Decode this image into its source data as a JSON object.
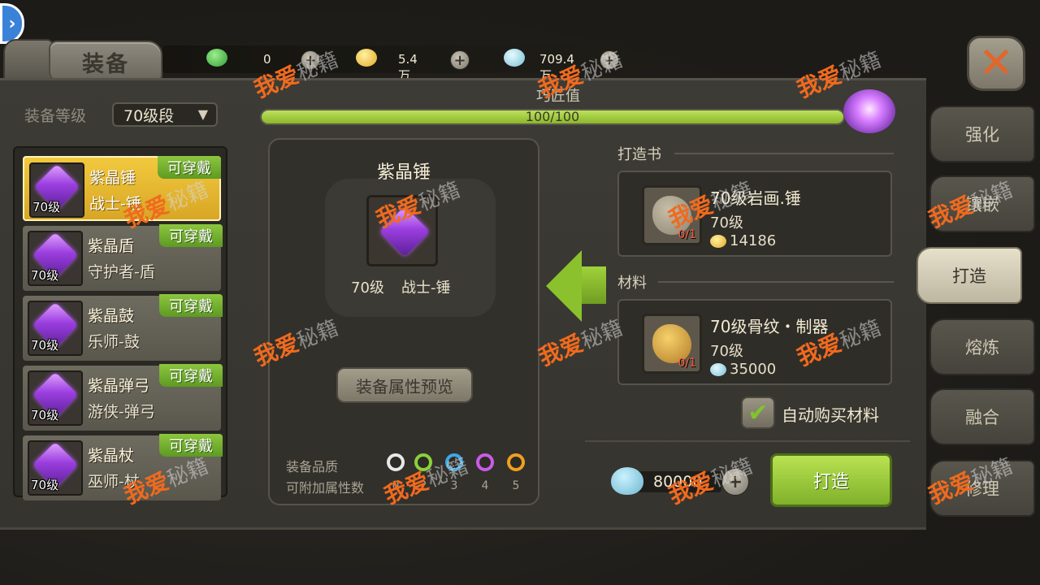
{
  "title": "装备",
  "currencies": [
    {
      "icon": "green-gem-icon",
      "value": "0",
      "color": "#3fb24a"
    },
    {
      "icon": "gold-coin-icon",
      "value": "5.4万",
      "color": "#f2c33a"
    },
    {
      "icon": "shell-icon",
      "value": "709.4万",
      "color": "#9fd7ea"
    }
  ],
  "level_filter": {
    "label": "装备等级",
    "selected": "70级段"
  },
  "progress": {
    "label": "巧匠值",
    "text": "100/100",
    "fraction": 1.0
  },
  "equipment_list": [
    {
      "name": "紫晶锤",
      "role": "战士-锤",
      "level": "70级",
      "tag": "可穿戴",
      "selected": true
    },
    {
      "name": "紫晶盾",
      "role": "守护者-盾",
      "level": "70级",
      "tag": "可穿戴",
      "selected": false
    },
    {
      "name": "紫晶鼓",
      "role": "乐师-鼓",
      "level": "70级",
      "tag": "可穿戴",
      "selected": false
    },
    {
      "name": "紫晶弹弓",
      "role": "游侠-弹弓",
      "level": "70级",
      "tag": "可穿戴",
      "selected": false
    },
    {
      "name": "紫晶杖",
      "role": "巫师-杖",
      "level": "70级",
      "tag": "可穿戴",
      "selected": false
    }
  ],
  "detail": {
    "name": "紫晶锤",
    "level": "70级",
    "class": "战士-锤",
    "preview_button": "装备属性预览",
    "quality_label": "装备品质",
    "attr_label": "可附加属性数",
    "qualities": [
      {
        "color": "#e8e8e8",
        "count": "0"
      },
      {
        "color": "#8bd13a",
        "count": "2"
      },
      {
        "color": "#3ea8e6",
        "count": "3"
      },
      {
        "color": "#c95ce8",
        "count": "4"
      },
      {
        "color": "#f0a020",
        "count": "5"
      }
    ]
  },
  "forge_book": {
    "section_title": "打造书",
    "name": "70级岩画.锤",
    "level": "70级",
    "owned": "0/1",
    "cost": "14186"
  },
  "material": {
    "section_title": "材料",
    "name": "70级骨纹・制器",
    "level": "70级",
    "owned": "0/1",
    "cost": "35000"
  },
  "auto_buy": {
    "label": "自动购买材料",
    "checked": true
  },
  "forge_cost": "80000",
  "forge_button": "打造",
  "tabs": [
    {
      "label": "强化",
      "active": false
    },
    {
      "label": "镶嵌",
      "active": false
    },
    {
      "label": "打造",
      "active": true
    },
    {
      "label": "熔炼",
      "active": false
    },
    {
      "label": "融合",
      "active": false
    },
    {
      "label": "修理",
      "active": false
    }
  ],
  "watermark": {
    "a": "我爱",
    "b": "秘籍"
  }
}
